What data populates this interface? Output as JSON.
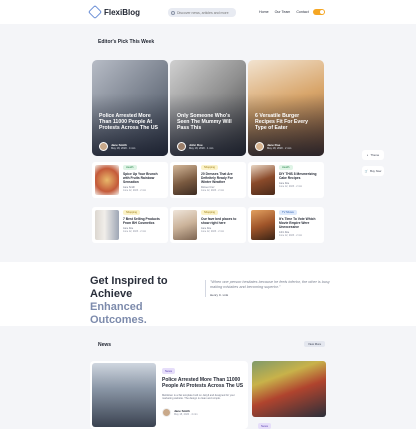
{
  "header": {
    "brand": "FlexiBlog",
    "search_placeholder": "Discover news, articles and more",
    "nav": [
      "Home",
      "Our Team",
      "Contact"
    ]
  },
  "editors": {
    "title": "Editor's Pick This Week",
    "big": [
      {
        "title": "Police Arrested More Than 11000 People At Protests Across The US",
        "author": "Jane Smith",
        "date": "May 18, 2020 · 4 min"
      },
      {
        "title": "Only Someone Who's Seen The Mummy Will Pass This",
        "author": "John Doe",
        "date": "May 18, 2020 · 1 min"
      },
      {
        "title": "6 Versatile Burger Recipes Fit For Every Type of Eater",
        "author": "Jane Doe",
        "date": "May 18, 2020 · 2 min"
      }
    ],
    "small": [
      {
        "badge": "Health",
        "title": "Spice Up Your Brunch with Fruits Rainbow Sensation",
        "author": "Jane Smith",
        "date": "June 12, 2023 · 2 min"
      },
      {
        "badge": "Shopping",
        "title": "20 Dresses That Are Definitely Ready For Winter Weather",
        "author": "Romeo Cruz",
        "date": "June 12, 2023 · 2 min"
      },
      {
        "badge": "Health",
        "title": "DIY THIS 8 Mesmerizing Cake Recipes",
        "author": "Jane Doe",
        "date": "June 12, 2023 · 2 min"
      },
      {
        "badge": "Shopping",
        "title": "7 Best Selling Products From BH Cosmetics",
        "author": "Jane Doe",
        "date": "June 12, 2023 · 2 min"
      },
      {
        "badge": "Shopping",
        "title": "Our fave bed places to show right here",
        "author": "Jane Doe",
        "date": "June 12, 2023 · 2 min"
      },
      {
        "badge": "TV Shows",
        "title": "It's Time To Vote Which Movie Empire Were Unexcessive",
        "author": "John Doe",
        "date": "June 12, 2023 · 2 min"
      }
    ]
  },
  "side_buttons": [
    "Theme",
    "Buy Now"
  ],
  "inspire": {
    "line1": "Get Inspired to Achieve",
    "line2": "Enhanced Outcomes.",
    "quote": "\"When one person hesitates because he feels inferior, the other is busy making mistakes and becoming superior.\"",
    "author": "Henry C. Link"
  },
  "news": {
    "title": "News",
    "view_all": "View More",
    "badge": "News",
    "headline": "Police Arrested More Than 11000 People At Protests Across The US",
    "excerpt": "Meltdown is a flat template built on Jekyll and designed for your marketing website. The design is clean and simple.",
    "author": "Jane Smith",
    "date": "May 18, 2020 · 4 min",
    "side_badge": "News"
  }
}
